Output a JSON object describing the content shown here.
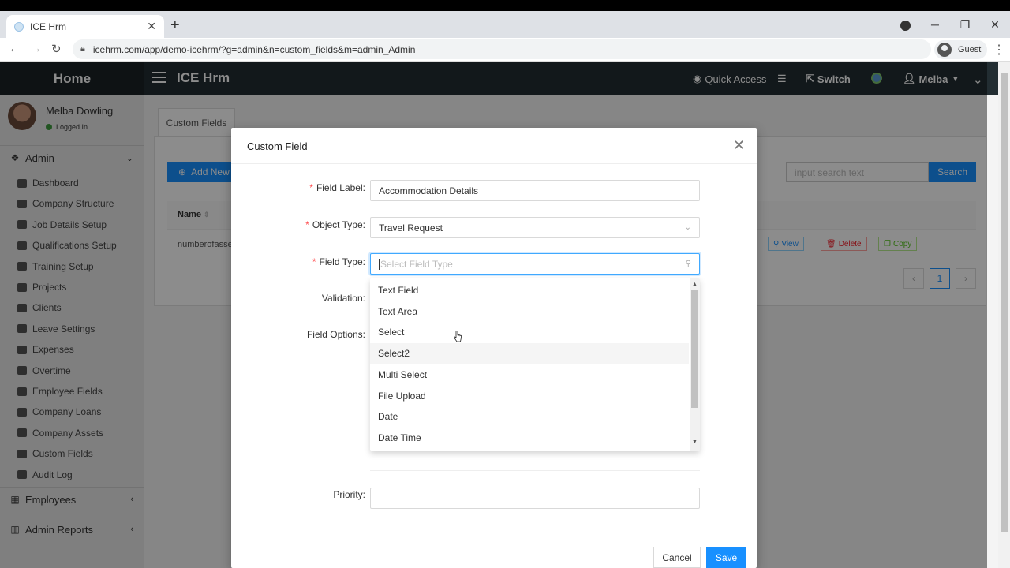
{
  "browser": {
    "tab_title": "ICE Hrm",
    "url": "icehrm.com/app/demo-icehrm/?g=admin&n=custom_fields&m=admin_Admin",
    "guest_label": "Guest"
  },
  "header": {
    "brand": "Home",
    "app_title": "ICE Hrm",
    "quick_access": "Quick Access",
    "switch": "Switch",
    "user": "Melba"
  },
  "sidebar": {
    "user_name": "Melba Dowling",
    "user_status": "Logged In",
    "admin_section": "Admin",
    "items": [
      {
        "label": "Dashboard"
      },
      {
        "label": "Company Structure"
      },
      {
        "label": "Job Details Setup"
      },
      {
        "label": "Qualifications Setup"
      },
      {
        "label": "Training Setup"
      },
      {
        "label": "Projects"
      },
      {
        "label": "Clients"
      },
      {
        "label": "Leave Settings"
      },
      {
        "label": "Expenses"
      },
      {
        "label": "Overtime"
      },
      {
        "label": "Employee Fields"
      },
      {
        "label": "Company Loans"
      },
      {
        "label": "Company Assets"
      },
      {
        "label": "Custom Fields"
      },
      {
        "label": "Audit Log"
      }
    ],
    "employees_section": "Employees",
    "admin_reports_section": "Admin Reports"
  },
  "main": {
    "tab": "Custom Fields",
    "add_new": "Add New",
    "search_placeholder": "input search text",
    "search_button": "Search",
    "column_name": "Name",
    "row_name": "numberofasse",
    "row_actions": {
      "view": "View",
      "delete": "Delete",
      "copy": "Copy"
    },
    "page": "1"
  },
  "modal": {
    "title": "Custom Field",
    "field_label_label": "Field Label",
    "field_label_value": "Accommodation Details",
    "object_type_label": "Object Type",
    "object_type_value": "Travel Request",
    "field_type_label": "Field Type",
    "field_type_placeholder": "Select Field Type",
    "validation_label": "Validation",
    "field_options_label": "Field Options",
    "priority_label": "Priority",
    "cancel": "Cancel",
    "save": "Save"
  },
  "dropdown": {
    "options": [
      {
        "label": "Text Field"
      },
      {
        "label": "Text Area"
      },
      {
        "label": "Select"
      },
      {
        "label": "Select2"
      },
      {
        "label": "Multi Select"
      },
      {
        "label": "File Upload"
      },
      {
        "label": "Date"
      },
      {
        "label": "Date Time"
      }
    ],
    "hovered_option": "Select2"
  },
  "colors": {
    "primary": "#1890ff",
    "header_bg": "#222d32",
    "required": "#ff4d4f"
  }
}
